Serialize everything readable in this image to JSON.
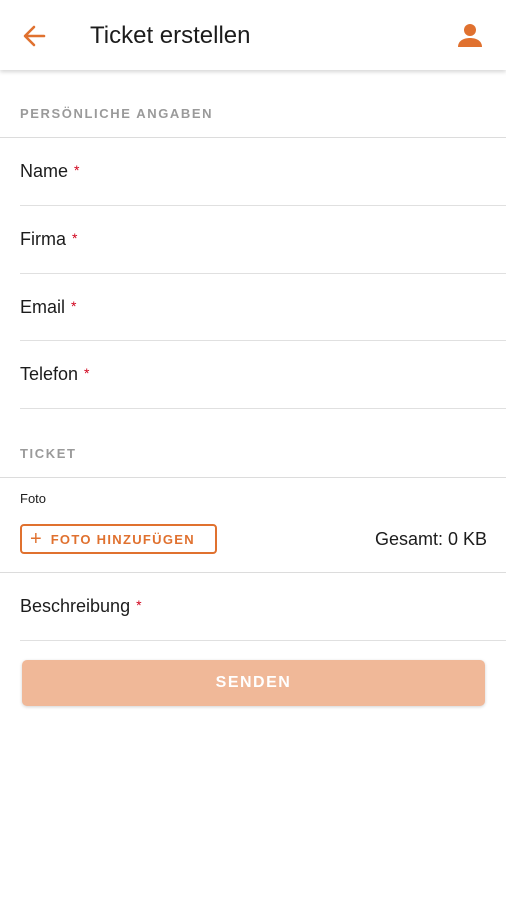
{
  "appbar": {
    "title": "Ticket erstellen",
    "back_icon": "arrow-left-icon",
    "profile_icon": "person-icon",
    "accent_color": "#e0712f"
  },
  "personal": {
    "header": "PERSÖNLICHE ANGABEN",
    "fields": [
      {
        "label": "Name",
        "required_mark": "*"
      },
      {
        "label": "Firma",
        "required_mark": "*"
      },
      {
        "label": "Email",
        "required_mark": "*"
      },
      {
        "label": "Telefon",
        "required_mark": "*"
      }
    ]
  },
  "ticket": {
    "header": "TICKET",
    "photo_label": "Foto",
    "add_photo_icon": "plus-icon",
    "add_photo_label": "FOTO HINZUFÜGEN",
    "total_size": "Gesamt: 0 KB",
    "description": {
      "label": "Beschreibung",
      "required_mark": "*"
    }
  },
  "actions": {
    "send_label": "SENDEN",
    "send_color": "#f0b898"
  }
}
